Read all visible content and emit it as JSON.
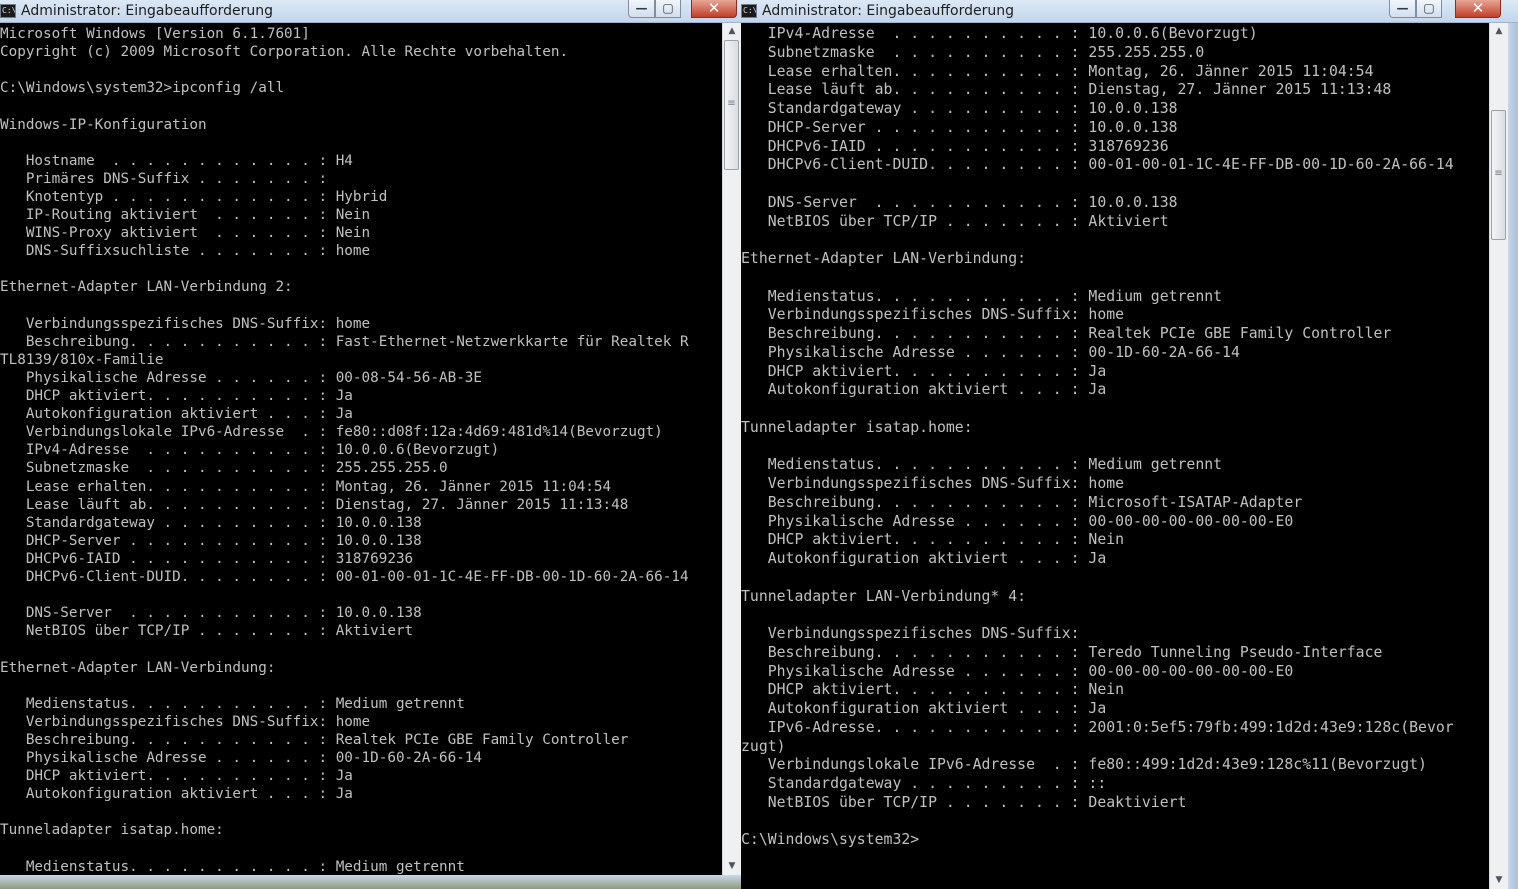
{
  "left_window": {
    "title": "Administrator: Eingabeaufforderung",
    "icon_label": "C:\\",
    "controls": {
      "minimize": "—",
      "maximize": "▢",
      "close": "✕"
    },
    "scrollbar": {
      "up_arrow": "▲",
      "down_arrow": "▼",
      "thumb_grip": "≡"
    },
    "lines": [
      "Microsoft Windows [Version 6.1.7601]",
      "Copyright (c) 2009 Microsoft Corporation. Alle Rechte vorbehalten.",
      "",
      "C:\\Windows\\system32>ipconfig /all",
      "",
      "Windows-IP-Konfiguration",
      "",
      "   Hostname  . . . . . . . . . . . . : H4",
      "   Primäres DNS-Suffix . . . . . . . :",
      "   Knotentyp . . . . . . . . . . . . : Hybrid",
      "   IP-Routing aktiviert  . . . . . . : Nein",
      "   WINS-Proxy aktiviert  . . . . . . : Nein",
      "   DNS-Suffixsuchliste . . . . . . . : home",
      "",
      "Ethernet-Adapter LAN-Verbindung 2:",
      "",
      "   Verbindungsspezifisches DNS-Suffix: home",
      "   Beschreibung. . . . . . . . . . . : Fast-Ethernet-Netzwerkkarte für Realtek R",
      "TL8139/810x-Familie",
      "   Physikalische Adresse . . . . . . : 00-08-54-56-AB-3E",
      "   DHCP aktiviert. . . . . . . . . . : Ja",
      "   Autokonfiguration aktiviert . . . : Ja",
      "   Verbindungslokale IPv6-Adresse  . : fe80::d08f:12a:4d69:481d%14(Bevorzugt)",
      "   IPv4-Adresse  . . . . . . . . . . : 10.0.0.6(Bevorzugt)",
      "   Subnetzmaske  . . . . . . . . . . : 255.255.255.0",
      "   Lease erhalten. . . . . . . . . . : Montag, 26. Jänner 2015 11:04:54",
      "   Lease läuft ab. . . . . . . . . . : Dienstag, 27. Jänner 2015 11:13:48",
      "   Standardgateway . . . . . . . . . : 10.0.0.138",
      "   DHCP-Server . . . . . . . . . . . : 10.0.0.138",
      "   DHCPv6-IAID . . . . . . . . . . . : 318769236",
      "   DHCPv6-Client-DUID. . . . . . . . : 00-01-00-01-1C-4E-FF-DB-00-1D-60-2A-66-14",
      "",
      "   DNS-Server  . . . . . . . . . . . : 10.0.0.138",
      "   NetBIOS über TCP/IP . . . . . . . : Aktiviert",
      "",
      "Ethernet-Adapter LAN-Verbindung:",
      "",
      "   Medienstatus. . . . . . . . . . . : Medium getrennt",
      "   Verbindungsspezifisches DNS-Suffix: home",
      "   Beschreibung. . . . . . . . . . . : Realtek PCIe GBE Family Controller",
      "   Physikalische Adresse . . . . . . : 00-1D-60-2A-66-14",
      "   DHCP aktiviert. . . . . . . . . . : Ja",
      "   Autokonfiguration aktiviert . . . : Ja",
      "",
      "Tunneladapter isatap.home:",
      "",
      "   Medienstatus. . . . . . . . . . . : Medium getrennt"
    ]
  },
  "right_window": {
    "title": "Administrator: Eingabeaufforderung",
    "icon_label": "C:\\",
    "controls": {
      "minimize": "—",
      "maximize": "▢",
      "close": "✕"
    },
    "scrollbar": {
      "up_arrow": "▲",
      "down_arrow": "▼",
      "thumb_grip": "≡"
    },
    "lines": [
      "   IPv4-Adresse  . . . . . . . . . . : 10.0.0.6(Bevorzugt)",
      "   Subnetzmaske  . . . . . . . . . . : 255.255.255.0",
      "   Lease erhalten. . . . . . . . . . : Montag, 26. Jänner 2015 11:04:54",
      "   Lease läuft ab. . . . . . . . . . : Dienstag, 27. Jänner 2015 11:13:48",
      "   Standardgateway . . . . . . . . . : 10.0.0.138",
      "   DHCP-Server . . . . . . . . . . . : 10.0.0.138",
      "   DHCPv6-IAID . . . . . . . . . . . : 318769236",
      "   DHCPv6-Client-DUID. . . . . . . . : 00-01-00-01-1C-4E-FF-DB-00-1D-60-2A-66-14",
      "",
      "   DNS-Server  . . . . . . . . . . . : 10.0.0.138",
      "   NetBIOS über TCP/IP . . . . . . . : Aktiviert",
      "",
      "Ethernet-Adapter LAN-Verbindung:",
      "",
      "   Medienstatus. . . . . . . . . . . : Medium getrennt",
      "   Verbindungsspezifisches DNS-Suffix: home",
      "   Beschreibung. . . . . . . . . . . : Realtek PCIe GBE Family Controller",
      "   Physikalische Adresse . . . . . . : 00-1D-60-2A-66-14",
      "   DHCP aktiviert. . . . . . . . . . : Ja",
      "   Autokonfiguration aktiviert . . . : Ja",
      "",
      "Tunneladapter isatap.home:",
      "",
      "   Medienstatus. . . . . . . . . . . : Medium getrennt",
      "   Verbindungsspezifisches DNS-Suffix: home",
      "   Beschreibung. . . . . . . . . . . : Microsoft-ISATAP-Adapter",
      "   Physikalische Adresse . . . . . . : 00-00-00-00-00-00-00-E0",
      "   DHCP aktiviert. . . . . . . . . . : Nein",
      "   Autokonfiguration aktiviert . . . : Ja",
      "",
      "Tunneladapter LAN-Verbindung* 4:",
      "",
      "   Verbindungsspezifisches DNS-Suffix:",
      "   Beschreibung. . . . . . . . . . . : Teredo Tunneling Pseudo-Interface",
      "   Physikalische Adresse . . . . . . : 00-00-00-00-00-00-00-E0",
      "   DHCP aktiviert. . . . . . . . . . : Nein",
      "   Autokonfiguration aktiviert . . . : Ja",
      "   IPv6-Adresse. . . . . . . . . . . : 2001:0:5ef5:79fb:499:1d2d:43e9:128c(Bevor",
      "zugt)",
      "   Verbindungslokale IPv6-Adresse  . : fe80::499:1d2d:43e9:128c%11(Bevorzugt)",
      "   Standardgateway . . . . . . . . . : ::",
      "   NetBIOS über TCP/IP . . . . . . . : Deaktiviert",
      "",
      "C:\\Windows\\system32>"
    ]
  }
}
